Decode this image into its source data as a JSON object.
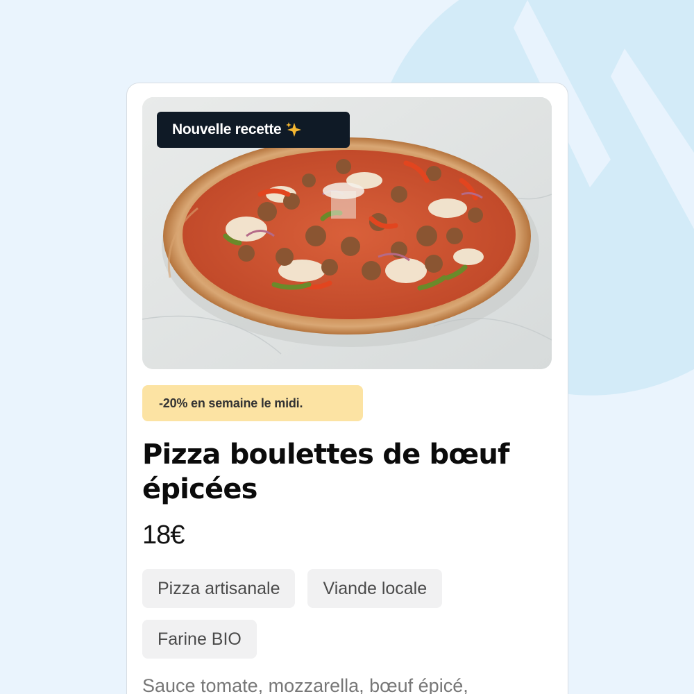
{
  "product": {
    "badge": "Nouvelle recette",
    "badge_icon": "sparkles-icon",
    "promo": "-20% en semaine le midi.",
    "title_line1": "Pizza boulettes de bœuf",
    "title_line2": "épicées",
    "price": "18€",
    "tags": [
      {
        "label": "Pizza artisanale"
      },
      {
        "label": "Viande locale"
      },
      {
        "label": "Farine BIO"
      }
    ],
    "description": "Sauce tomate, mozzarella, bœuf épicé,"
  },
  "colors": {
    "background": "#eaf4fd",
    "background_shape": "#d3ebf8",
    "badge_bg": "#0f1a26",
    "promo_bg": "#fce3a3",
    "tag_bg": "#f1f1f2",
    "sparkle": "#f5b731"
  }
}
